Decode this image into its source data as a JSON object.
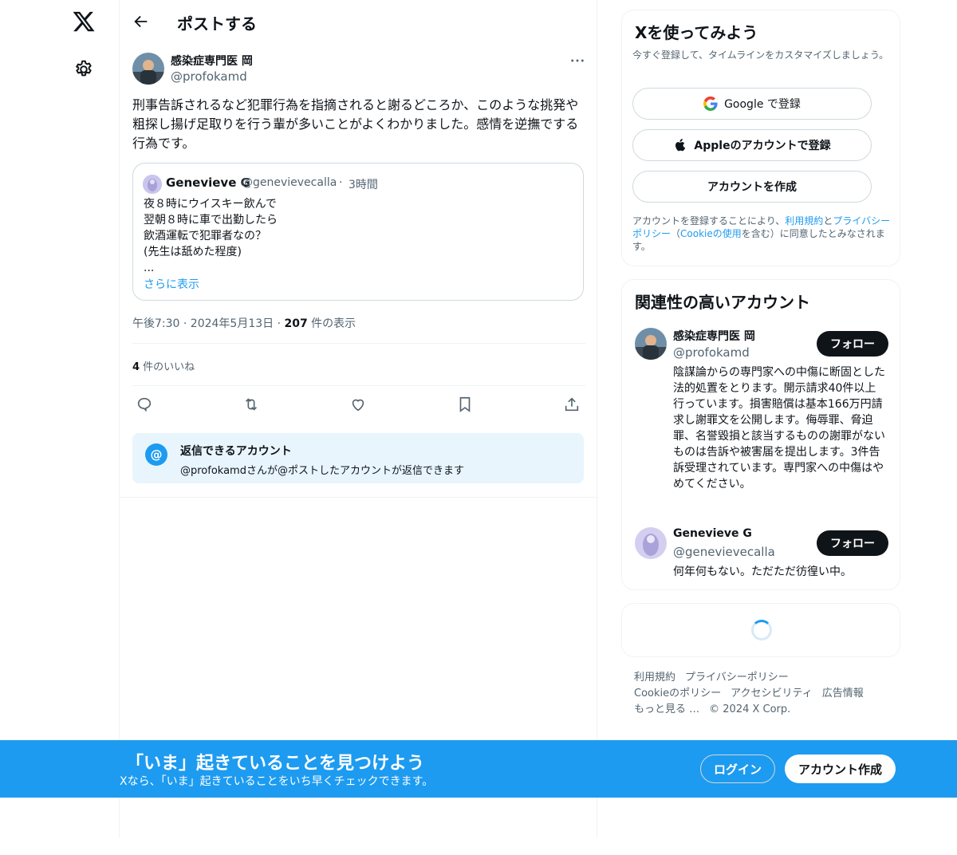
{
  "colors": {
    "accent": "#1d9bf0",
    "text": "#0f1419",
    "muted": "#536471",
    "reply_bg": "#e8f5fd"
  },
  "header": {
    "title": "ポストする",
    "back_icon": "arrow-left-icon"
  },
  "post": {
    "author_name": "感染症専門医 岡",
    "author_handle": "@profokamd",
    "text": "刑事告訴されるなど犯罪行為を指摘されると謝るどころか、このような挑発や粗探し揚げ足取りを行う輩が多いことがよくわかりました。感情を逆撫でする行為です。",
    "quote": {
      "name": "Genevieve G",
      "handle": "@genevievecalla",
      "separator": "·",
      "time": "3時間",
      "lines": [
        "夜８時にウイスキー飲んで",
        "翌朝８時に車で出勤したら",
        "飲酒運転で犯罪者なの？",
        "(先生は舐めた程度)",
        "..."
      ],
      "show_more": "さらに表示"
    },
    "timestamp": "午後7:30 · 2024年5月13日 · ",
    "views_count": "207",
    "views_label": " 件の表示",
    "likes_count": "4",
    "likes_label": " 件のいいね",
    "actions": [
      "reply-icon",
      "repost-icon",
      "like-icon",
      "bookmark-icon",
      "share-icon"
    ],
    "reply_restriction": {
      "title": "返信できるアカウント",
      "desc": "@profokamdさんが@ポストしたアカウントが返信できます"
    }
  },
  "signup": {
    "title": "Xを使ってみよう",
    "subtitle": "今すぐ登録して、タイムラインをカスタマイズしましょう。",
    "google_label": "Google で登録",
    "apple_label": "Appleのアカウントで登録",
    "create_label": "アカウントを作成",
    "legal_1": "アカウントを登録することにより、",
    "legal_terms": "利用規約",
    "legal_and": "と",
    "legal_privacy": "プライバシーポリシー",
    "legal_2": "（",
    "legal_cookie": "Cookieの使用",
    "legal_3": "を含む）に同意したとみなされます。"
  },
  "relevant": {
    "title": "関連性の高いアカウント",
    "accounts": [
      {
        "name": "感染症専門医 岡",
        "handle": "@profokamd",
        "bio": "陰謀論からの専門家への中傷に断固とした法的処置をとります。開示請求40件以上行っています。損害賠償は基本166万円請求し謝罪文を公開します。侮辱罪、脅迫罪、名誉毀損と該当するものの謝罪がないものは告訴や被害届を提出します。3件告訴受理されています。専門家への中傷はやめてください。",
        "follow": "フォロー"
      },
      {
        "name": "Genevieve G",
        "handle": "@genevievecalla",
        "bio": "何年何もない。ただただ彷徨い中。",
        "follow": "フォロー"
      }
    ]
  },
  "footer": {
    "links": [
      "利用規約",
      "プライバシーポリシー",
      "Cookieのポリシー",
      "アクセシビリティ",
      "広告情報",
      "もっと見る …"
    ],
    "copyright": "© 2024 X Corp."
  },
  "banner": {
    "title": "「いま」起きていることを見つけよう",
    "subtitle": "Xなら、「いま」起きていることをいち早くチェックできます。",
    "login": "ログイン",
    "signup": "アカウント作成"
  }
}
